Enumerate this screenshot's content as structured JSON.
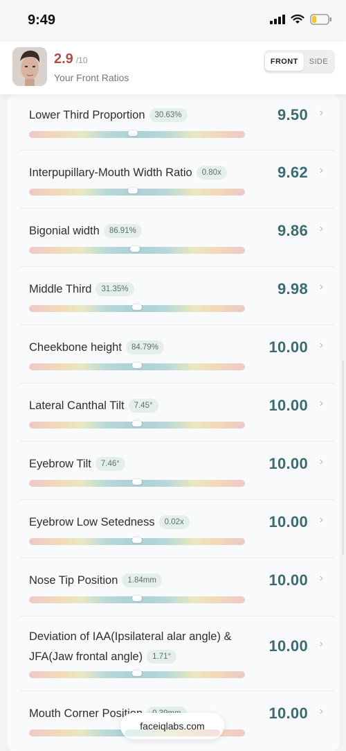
{
  "status_bar": {
    "time": "9:49"
  },
  "header": {
    "score": "2.9",
    "score_max": "/10",
    "subtitle": "Your Front Ratios",
    "tabs": [
      {
        "label": "FRONT",
        "active": true
      },
      {
        "label": "SIDE",
        "active": false
      }
    ]
  },
  "metrics": [
    {
      "name": "Lower Third Proportion",
      "value": "30.63%",
      "score": "9.50",
      "position": 0.48
    },
    {
      "name": "Interpupillary-Mouth Width Ratio",
      "value": "0.80x",
      "score": "9.62",
      "position": 0.48
    },
    {
      "name": "Bigonial width",
      "value": "86.91%",
      "score": "9.86",
      "position": 0.49
    },
    {
      "name": "Middle Third",
      "value": "31.35%",
      "score": "9.98",
      "position": 0.5
    },
    {
      "name": "Cheekbone height",
      "value": "84.79%",
      "score": "10.00",
      "position": 0.5
    },
    {
      "name": "Lateral Canthal Tilt",
      "value": "7.45°",
      "score": "10.00",
      "position": 0.5
    },
    {
      "name": "Eyebrow Tilt",
      "value": "7.46°",
      "score": "10.00",
      "position": 0.5
    },
    {
      "name": "Eyebrow Low Setedness",
      "value": "0.02x",
      "score": "10.00",
      "position": 0.5
    },
    {
      "name": "Nose Tip Position",
      "value": "1.84mm",
      "score": "10.00",
      "position": 0.5
    },
    {
      "name": "Deviation of IAA(Ipsilateral alar angle) & JFA(Jaw frontal angle)",
      "value": "1.71°",
      "score": "10.00",
      "position": 0.5
    },
    {
      "name": "Mouth Corner Position",
      "value": "0.39mm",
      "score": "10.00",
      "position": 0.5
    }
  ],
  "footer": {
    "site": "faceiqlabs.com"
  }
}
